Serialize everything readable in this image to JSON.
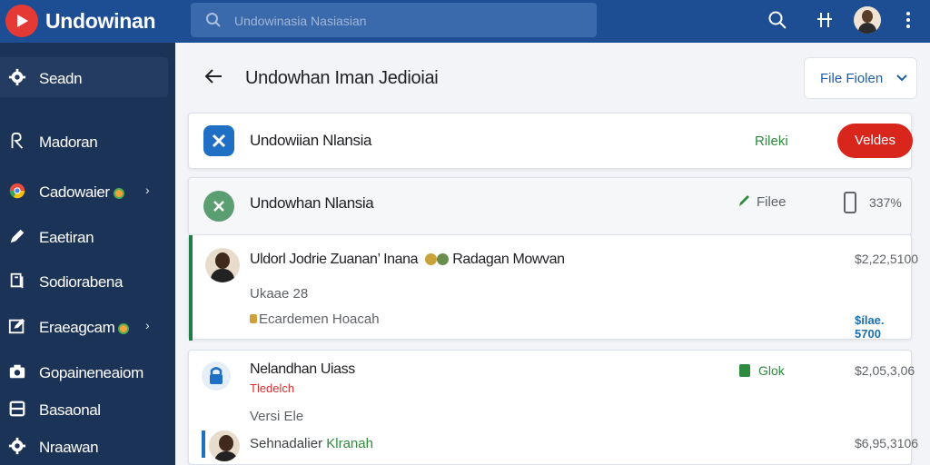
{
  "app": {
    "brand": "Undowinan"
  },
  "search": {
    "placeholder": "Undowinasia Nasiasian"
  },
  "sidebar": {
    "items": [
      {
        "label": "Seadn",
        "icon": "gear-icon",
        "active": true
      },
      {
        "label": "Madoran",
        "icon": "person-icon"
      },
      {
        "label": "Cadowaier",
        "icon": "chrome-icon",
        "badge": true,
        "chevron": true
      },
      {
        "label": "Eaetiran",
        "icon": "pen-icon"
      },
      {
        "label": "Sodiorabena",
        "icon": "document-icon"
      },
      {
        "label": "Eraeagcam",
        "icon": "edit-box-icon",
        "badge": true,
        "chevron": true
      },
      {
        "label": "Gopaineneaiom",
        "icon": "camera-icon"
      },
      {
        "label": "Basaonal",
        "icon": "folder-icon"
      },
      {
        "label": "Nraawan",
        "icon": "gear-icon"
      }
    ]
  },
  "main": {
    "title": "Undowhan Iman Jedioiai",
    "file_dropdown": "File Fiolen",
    "card1": {
      "title": "Undowiian Nlansia",
      "link": "Rileki",
      "button": "Veldes"
    },
    "card2": {
      "title": "Undowhan Nlansia",
      "file_label": "Filee",
      "percent": "337%"
    },
    "card3": {
      "name_line": "Uldorl Jodrie Zuanan’ Inana",
      "name_suffix": "Radagan Mowvan",
      "sub1": "Ukaae 28",
      "sub2": "Ecardemen Hoacah",
      "amount": "$2,22,5100",
      "blue_amount": "$ílae. 5700"
    },
    "card4": {
      "title": "Nelandhan Uiass",
      "red_label": "Tledelch",
      "status": "Glok",
      "amount": "$2,05,3,06",
      "sub1": "Versi Ele",
      "author": "Sehnadalier",
      "author_link": "Klranah",
      "amount2": "$6,95,3106"
    }
  },
  "colors": {
    "topbar": "#1d4e93",
    "sidebar": "#1c3358",
    "accent_red": "#d8261d",
    "accent_green": "#2e8b3d",
    "accent_blue": "#1a6fb5"
  }
}
